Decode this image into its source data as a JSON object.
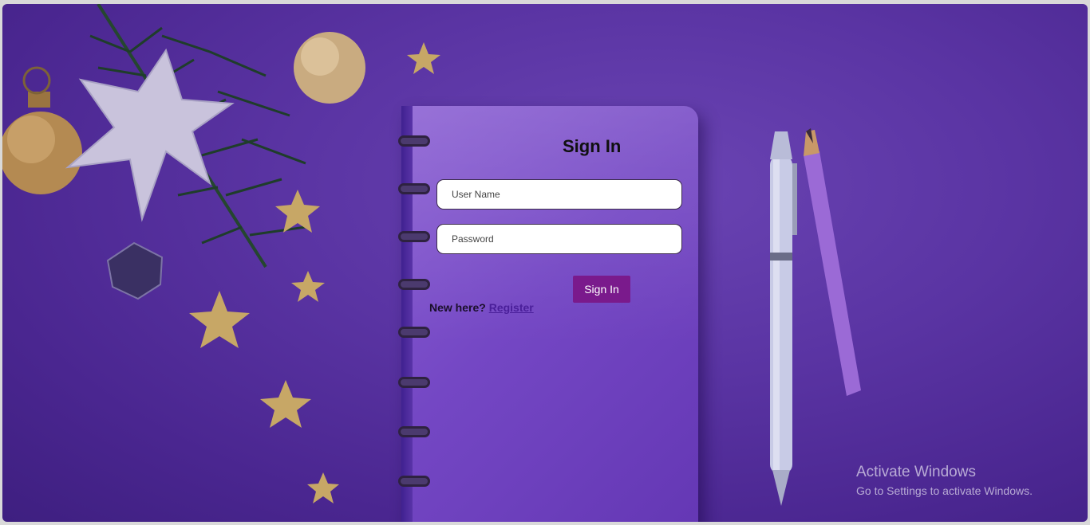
{
  "form": {
    "title": "Sign In",
    "username_placeholder": "User Name",
    "password_placeholder": "Password",
    "signin_label": "Sign In",
    "new_here_text": "New here?",
    "register_label": "Register"
  },
  "watermark": {
    "title": "Activate Windows",
    "subtitle": "Go to Settings to activate Windows."
  },
  "colors": {
    "background": "#5a34a3",
    "notebook": "#7447c4",
    "button": "#7a1a8c",
    "link": "#4a1f9a"
  },
  "decorations": [
    "pine-branch",
    "silver-star",
    "gold-ornament",
    "gold-stars",
    "pen",
    "pencil"
  ]
}
